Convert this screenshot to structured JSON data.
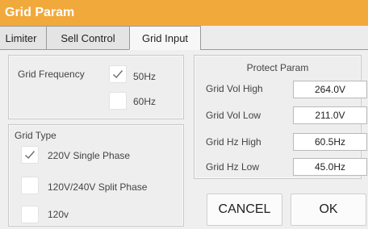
{
  "window": {
    "title": "Grid Param"
  },
  "tabs": [
    {
      "label": "Limiter"
    },
    {
      "label": "Sell Control"
    },
    {
      "label": "Grid Input"
    }
  ],
  "grid_frequency": {
    "label": "Grid Frequency",
    "options": [
      {
        "label": "50Hz",
        "checked": true
      },
      {
        "label": "60Hz",
        "checked": false
      }
    ]
  },
  "grid_type": {
    "label": "Grid Type",
    "options": [
      {
        "label": "220V Single Phase",
        "checked": true
      },
      {
        "label": "120V/240V Split Phase",
        "checked": false
      },
      {
        "label": "120v",
        "checked": false
      }
    ]
  },
  "protect_param": {
    "title": "Protect Param",
    "rows": [
      {
        "label": "Grid Vol High",
        "value": "264.0V"
      },
      {
        "label": "Grid Vol Low",
        "value": "211.0V"
      },
      {
        "label": "Grid Hz High",
        "value": "60.5Hz"
      },
      {
        "label": "Grid Hz Low",
        "value": "45.0Hz"
      }
    ]
  },
  "buttons": {
    "cancel": "CANCEL",
    "ok": "OK"
  },
  "colors": {
    "title_bar": "#f2a93b",
    "title_text": "#ffffff"
  },
  "icons": {
    "checkmark": "checkmark-icon"
  }
}
